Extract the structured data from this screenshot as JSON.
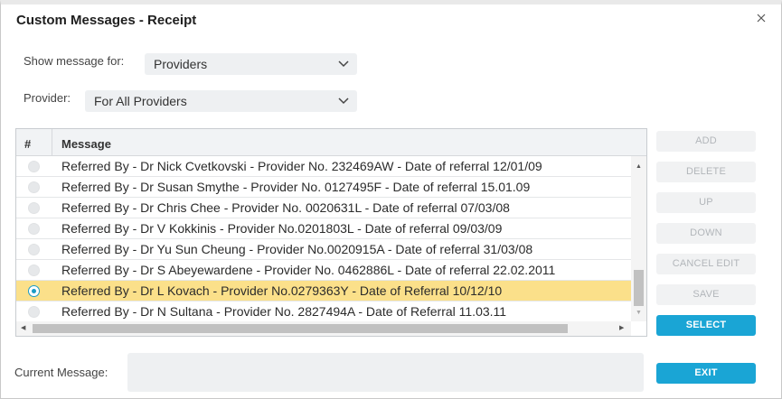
{
  "dialog": {
    "title": "Custom Messages - Receipt"
  },
  "filters": {
    "show_for_label": "Show message for:",
    "show_for_value": "Providers",
    "provider_label": "Provider:",
    "provider_value": "For All Providers"
  },
  "grid": {
    "columns": [
      "#",
      "Message"
    ],
    "rows": [
      {
        "message": "Referred By - Dr Nick Cvetkovski - Provider No. 232469AW - Date of referral 12/01/09",
        "selected": false
      },
      {
        "message": "Referred By - Dr Susan Smythe - Provider No. 0127495F - Date of referral 15.01.09",
        "selected": false
      },
      {
        "message": "Referred By - Dr Chris Chee - Provider No. 0020631L - Date of referral 07/03/08",
        "selected": false
      },
      {
        "message": "Referred By - Dr V Kokkinis - Provider No.0201803L - Date of referral 09/03/09",
        "selected": false
      },
      {
        "message": "Referred By - Dr Yu Sun Cheung - Provider No.0020915A - Date of referral 31/03/08",
        "selected": false
      },
      {
        "message": "Referred By - Dr S Abeyewardene - Provider No. 0462886L - Date of referral 22.02.2011",
        "selected": false
      },
      {
        "message": "Referred By - Dr L Kovach - Provider No.0279363Y - Date of Referral 10/12/10",
        "selected": true
      },
      {
        "message": "Referred By - Dr N Sultana - Provider No. 2827494A - Date of Referral 11.03.11",
        "selected": false
      }
    ]
  },
  "actions": {
    "add": "ADD",
    "delete": "DELETE",
    "up": "UP",
    "down": "DOWN",
    "cancel_edit": "CANCEL EDIT",
    "save": "SAVE",
    "select": "SELECT",
    "exit": "EXIT"
  },
  "current": {
    "label": "Current Message:",
    "value": ""
  },
  "colors": {
    "accent": "#1aa5d5",
    "selected_row": "#fbe08a"
  },
  "icons": {
    "close": "close-icon",
    "dropdown": "chevron-down-icon"
  }
}
